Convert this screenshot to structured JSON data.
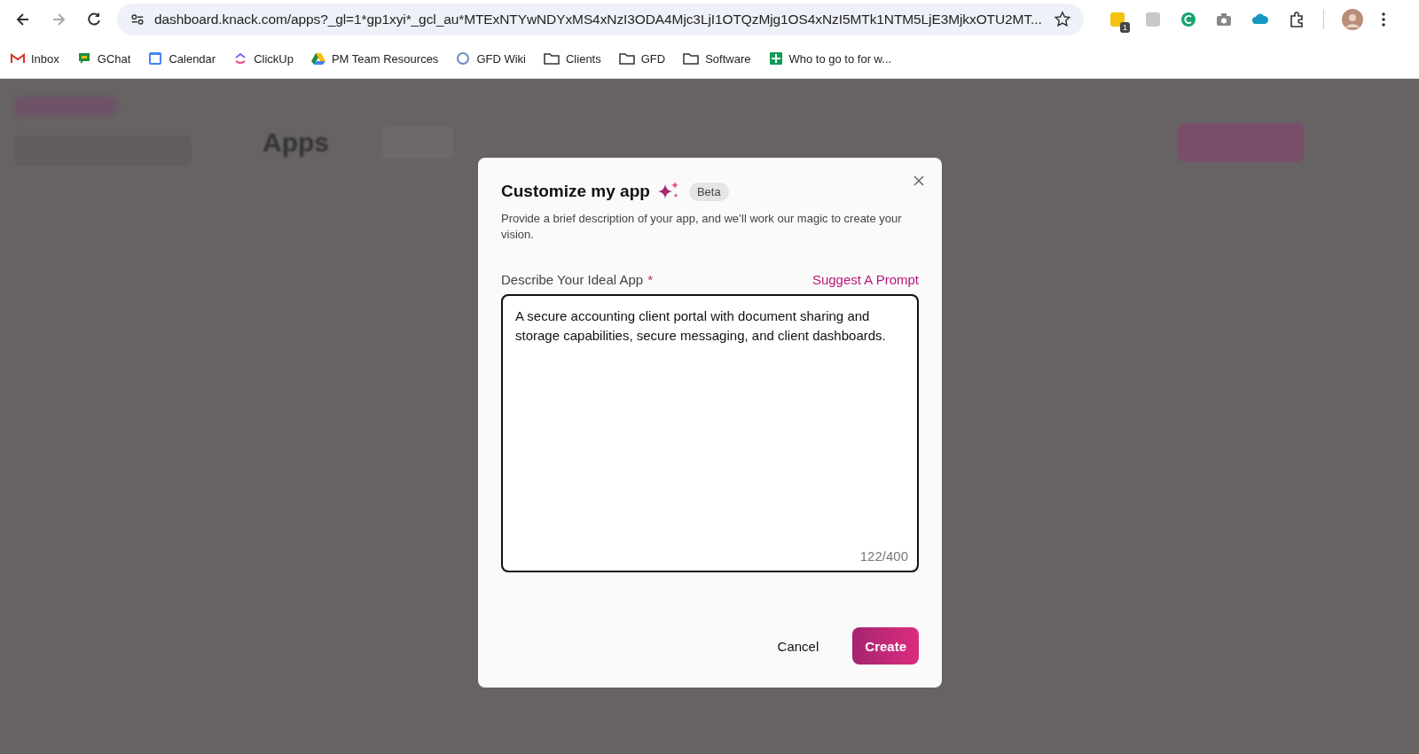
{
  "browser": {
    "url": "dashboard.knack.com/apps?_gl=1*gp1xyi*_gcl_au*MTExNTYwNDYxMS4xNzI3ODA4Mjc3LjI1OTQzMjg1OS4xNzI5MTk1NTM5LjE3MjkxOTU2MT...",
    "extension_badge": "1",
    "bookmarks": [
      {
        "label": "Inbox",
        "kind": "mail"
      },
      {
        "label": "GChat",
        "kind": "chat"
      },
      {
        "label": "Calendar",
        "kind": "calendar"
      },
      {
        "label": "ClickUp",
        "kind": "clickup"
      },
      {
        "label": "PM Team Resources",
        "kind": "drive"
      },
      {
        "label": "GFD Wiki",
        "kind": "wiki"
      },
      {
        "label": "Clients",
        "kind": "folder"
      },
      {
        "label": "GFD",
        "kind": "folder"
      },
      {
        "label": "Software",
        "kind": "folder"
      },
      {
        "label": "Who to go to for w...",
        "kind": "sheet"
      }
    ]
  },
  "page": {
    "heading": "Apps"
  },
  "modal": {
    "title": "Customize my app",
    "badge": "Beta",
    "description": "Provide a brief description of your app, and we’ll work our magic to create your vision.",
    "field_label": "Describe Your Ideal App",
    "required_mark": "*",
    "suggest_link": "Suggest A Prompt",
    "value": "A secure accounting client portal with document sharing and storage capabilities, secure messaging, and client dashboards.",
    "counter": "122/400",
    "buttons": [
      {
        "label": "Cancel",
        "kind": "secondary"
      },
      {
        "label": "Create",
        "kind": "primary"
      }
    ]
  }
}
